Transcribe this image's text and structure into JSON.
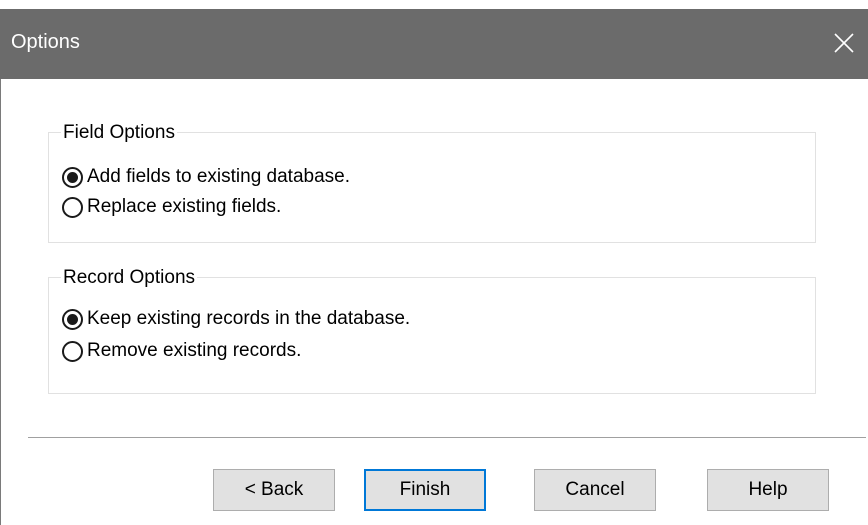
{
  "window": {
    "title": "Options"
  },
  "field_options": {
    "legend": "Field Options",
    "options": [
      {
        "label": "Add fields to existing database.",
        "checked": true
      },
      {
        "label": "Replace existing fields.",
        "checked": false
      }
    ]
  },
  "record_options": {
    "legend": "Record Options",
    "options": [
      {
        "label": "Keep existing records in the database.",
        "checked": true
      },
      {
        "label": "Remove existing records.",
        "checked": false
      }
    ]
  },
  "buttons": {
    "back": "< Back",
    "finish": "Finish",
    "cancel": "Cancel",
    "help": "Help"
  },
  "icons": {
    "close": "close-icon"
  },
  "colors": {
    "titlebar": "#6b6b6b",
    "default_button_border": "#0078d7",
    "button_face": "#e1e1e1"
  }
}
